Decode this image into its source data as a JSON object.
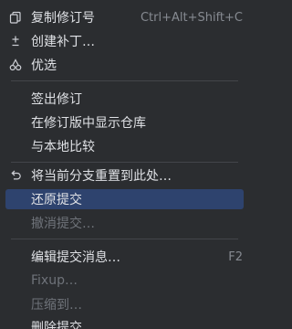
{
  "menu": {
    "copy_revision": {
      "label": "复制修订号",
      "shortcut": "Ctrl+Alt+Shift+C",
      "icon": "copy-icon"
    },
    "create_patch": {
      "label": "创建补丁…",
      "icon": "plus-minus-icon"
    },
    "cherry_pick": {
      "label": "优选",
      "icon": "cherry-icon"
    },
    "checkout_revision": {
      "label": "签出修订"
    },
    "show_repo_at_revision": {
      "label": "在修订版中显示仓库"
    },
    "compare_with_local": {
      "label": "与本地比较"
    },
    "reset_branch": {
      "label": "将当前分支重置到此处…",
      "icon": "undo-arrow-icon"
    },
    "revert_commit": {
      "label": "还原提交",
      "state": "selected"
    },
    "undo_commit": {
      "label": "撤消提交…",
      "state": "disabled"
    },
    "edit_commit_message": {
      "label": "编辑提交消息…",
      "shortcut": "F2"
    },
    "fixup": {
      "label": "Fixup…",
      "state": "disabled"
    },
    "squash_into": {
      "label": "压缩到…",
      "state": "disabled"
    },
    "drop_commit": {
      "label": "删除提交"
    }
  },
  "colors": {
    "background": "#2b2d30",
    "text": "#dfe1e5",
    "disabled_text": "#6f737a",
    "shortcut_text": "#868a91",
    "selection": "#2e436e",
    "separator": "#43454a"
  }
}
